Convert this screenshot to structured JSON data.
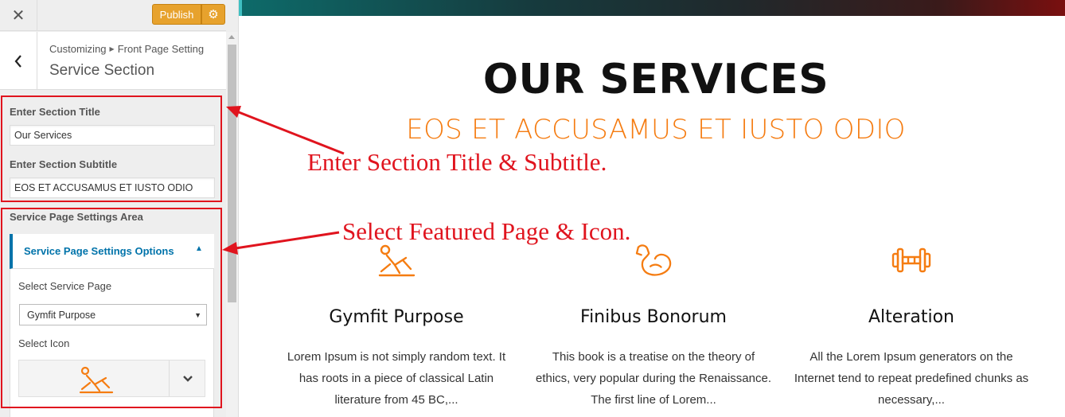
{
  "topbar": {
    "close_glyph": "✕",
    "publish_label": "Publish",
    "settings_glyph": "⚙"
  },
  "section_header": {
    "back_glyph": "‹",
    "breadcrumb_root": "Customizing",
    "breadcrumb_separator": "▶",
    "breadcrumb_parent": "Front Page Setting",
    "title": "Service Section"
  },
  "controls": {
    "title_label": "Enter Section Title",
    "title_value": "Our Services",
    "subtitle_label": "Enter Section Subtitle",
    "subtitle_value": "EOS ET ACCUSAMUS ET IUSTO ODIO",
    "area_label": "Service Page Settings Area",
    "accordion_label": "Service Page Settings Options",
    "accordion_caret": "▲",
    "select_page_label": "Select Service Page",
    "select_page_value": "Gymfit Purpose",
    "select_arrow": "▼",
    "select_icon_label": "Select Icon",
    "icon_value": "sit-up-icon"
  },
  "annotations": {
    "title_note": "Enter Section Title & Subtitle.",
    "page_note": "Select Featured Page & Icon.",
    "color": "#e0141e"
  },
  "preview": {
    "heading": "OUR SERVICES",
    "subheading": "EOS ET ACCUSAMUS ET IUSTO ODIO",
    "accent_color": "#f57c11",
    "services": [
      {
        "icon": "sit-up-icon",
        "title": "Gymfit Purpose",
        "text": "Lorem Ipsum is not simply random text. It has roots in a piece of classical Latin literature from 45 BC,..."
      },
      {
        "icon": "flexed-bicep-icon",
        "title": "Finibus Bonorum",
        "text": "This book is a treatise on the theory of ethics, very popular during the Renaissance. The first line of Lorem..."
      },
      {
        "icon": "dumbbell-icon",
        "title": "Alteration",
        "text": "All the Lorem Ipsum generators on the Internet tend to repeat predefined chunks as necessary,..."
      }
    ]
  },
  "colors": {
    "publish": "#e7a22d",
    "link_blue": "#0073aa"
  }
}
